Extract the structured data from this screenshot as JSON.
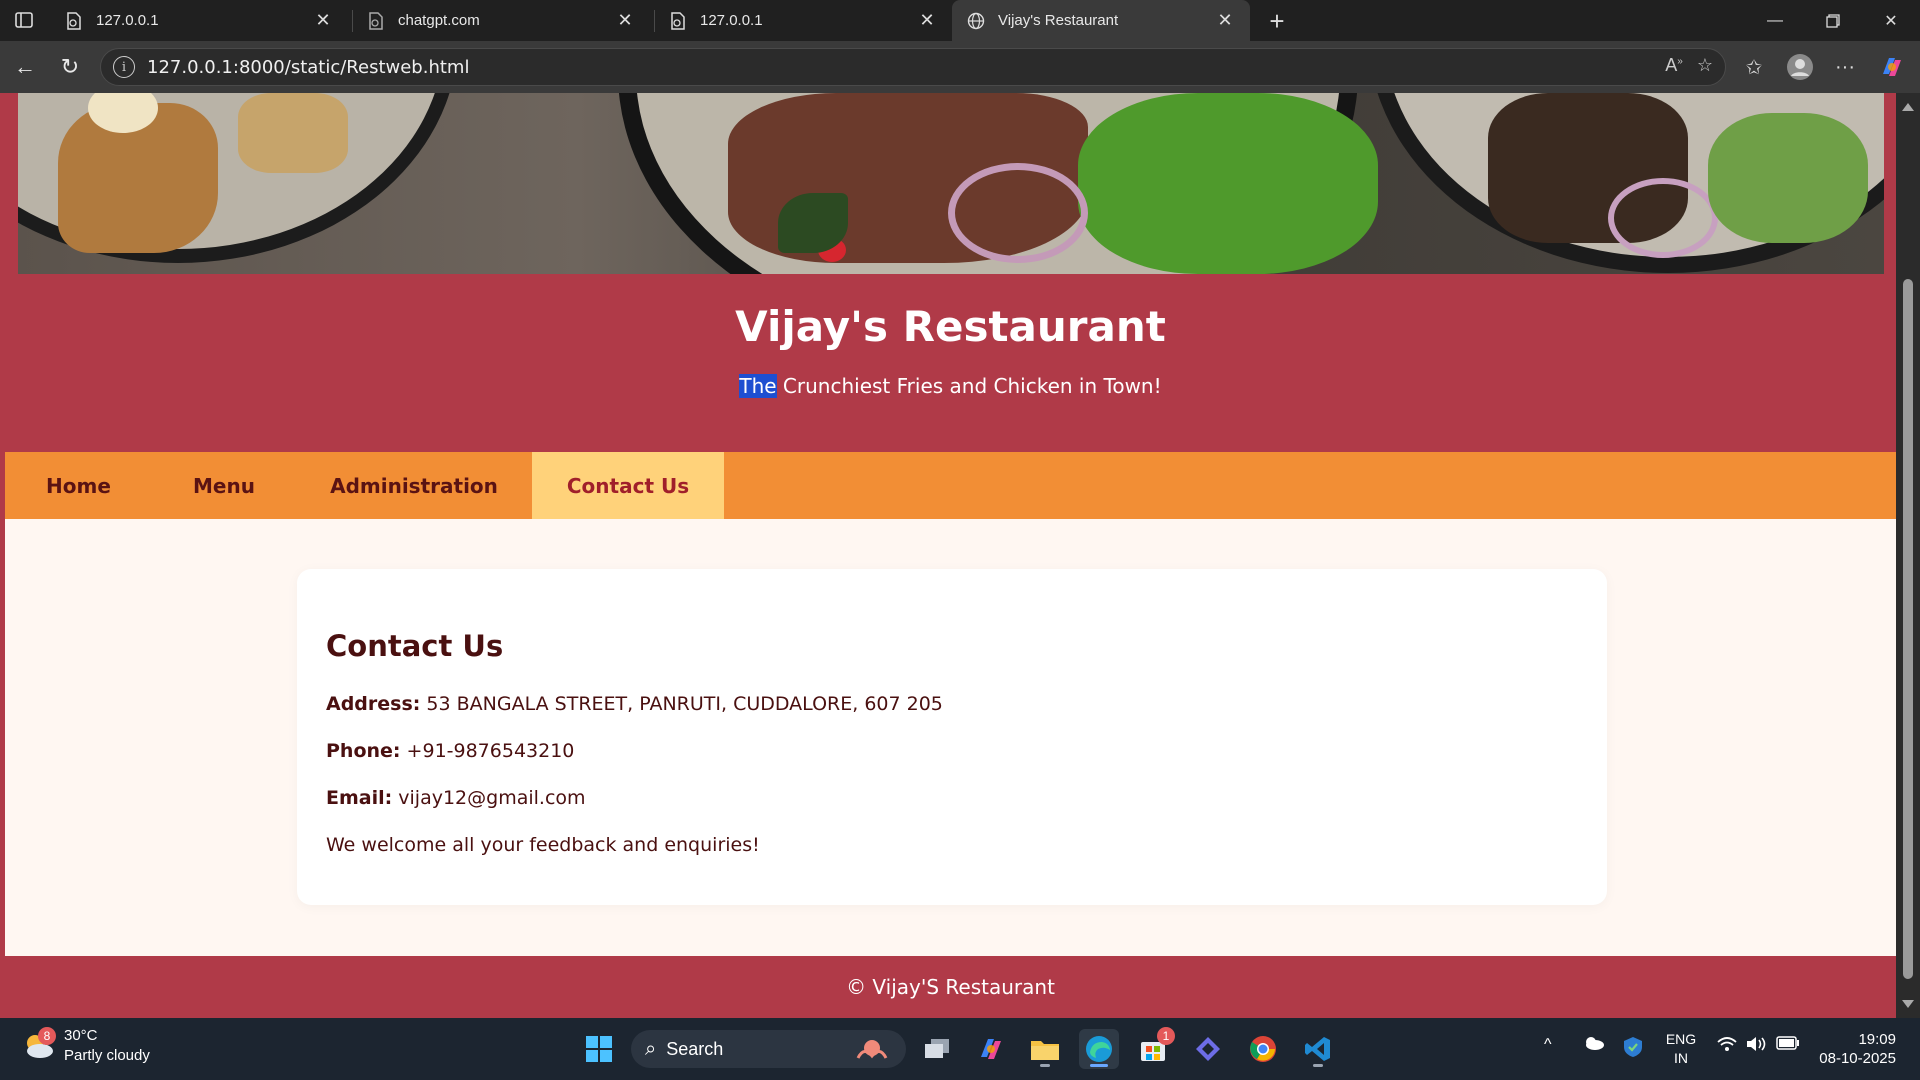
{
  "browser": {
    "tabs": [
      {
        "title": "127.0.0.1",
        "active": false
      },
      {
        "title": "chatgpt.com",
        "active": false
      },
      {
        "title": "127.0.0.1",
        "active": false
      },
      {
        "title": "Vijay's Restaurant",
        "active": true
      }
    ],
    "url": "127.0.0.1:8000/static/Restweb.html"
  },
  "site": {
    "title": "Vijay's Restaurant",
    "tagline_selected": "The",
    "tagline_rest": " Crunchiest Fries and Chicken in Town!",
    "nav": [
      {
        "label": "Home",
        "active": false
      },
      {
        "label": "Menu",
        "active": false
      },
      {
        "label": "Administration",
        "active": false
      },
      {
        "label": "Contact Us",
        "active": true
      }
    ],
    "contact": {
      "heading": "Contact Us",
      "address_label": "Address:",
      "address_value": " 53 BANGALA STREET, PANRUTI, CUDDALORE, 607 205",
      "phone_label": "Phone:",
      "phone_value": " +91-9876543210",
      "email_label": "Email:",
      "email_value": " vijay12@gmail.com",
      "message": "We welcome all your feedback and enquiries!"
    },
    "footer": "© Vijay'S Restaurant"
  },
  "taskbar": {
    "weather_temp": "30°C",
    "weather_desc": "Partly cloudy",
    "weather_badge": "8",
    "search_label": "Search",
    "store_badge": "1",
    "lang_line1": "ENG",
    "lang_line2": "IN",
    "time": "19:09",
    "date": "08-10-2025"
  },
  "colors": {
    "header_bg": "#b03a48",
    "nav_bg": "#f28e35",
    "nav_active_bg": "#ffd27a",
    "content_bg": "#fff7f2",
    "text_dark": "#4a1010"
  }
}
